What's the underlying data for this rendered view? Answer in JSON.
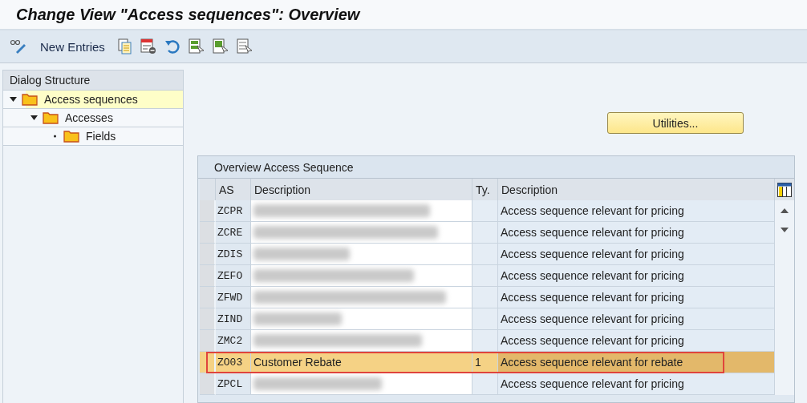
{
  "window": {
    "title": "Change View \"Access sequences\": Overview"
  },
  "toolbar": {
    "new_entries": "New Entries"
  },
  "dialog_structure": {
    "title": "Dialog Structure",
    "items": [
      {
        "label": "Access sequences",
        "expanded": true,
        "selected": true,
        "children": [
          {
            "label": "Accesses",
            "expanded": true,
            "selected": false,
            "children": [
              {
                "label": "Fields",
                "expanded": false,
                "selected": false
              }
            ]
          }
        ]
      }
    ]
  },
  "utilities_button": "Utilities...",
  "table": {
    "title": "Overview Access Sequence",
    "columns": [
      "AS",
      "Description",
      "Ty.",
      "Description"
    ],
    "rows": [
      {
        "as": "ZCPR",
        "blurred": true,
        "description": "Access sequence relevant for pricing",
        "selected": false,
        "marked": false
      },
      {
        "as": "ZCRE",
        "blurred": true,
        "description": "Access sequence relevant for pricing",
        "selected": false,
        "marked": false
      },
      {
        "as": "ZDIS",
        "blurred": true,
        "description": "Access sequence relevant for pricing",
        "selected": false,
        "marked": false
      },
      {
        "as": "ZEFO",
        "blurred": true,
        "description": "Access sequence relevant for pricing",
        "selected": false,
        "marked": false
      },
      {
        "as": "ZFWD",
        "blurred": true,
        "description": "Access sequence relevant for pricing",
        "selected": false,
        "marked": false
      },
      {
        "as": "ZIND",
        "blurred": true,
        "description": "Access sequence relevant for pricing",
        "selected": false,
        "marked": false
      },
      {
        "as": "ZMC2",
        "blurred": true,
        "description": "Access sequence relevant for pricing",
        "selected": false,
        "marked": false
      },
      {
        "as": "ZO03",
        "blurred": false,
        "name": "Customer Rebate",
        "ty": "1",
        "description": "Access sequence relevant for rebate",
        "selected": true,
        "marked": true
      },
      {
        "as": "ZPCL",
        "blurred": true,
        "description": "Access sequence relevant for pricing",
        "selected": false,
        "marked": false
      }
    ]
  }
}
